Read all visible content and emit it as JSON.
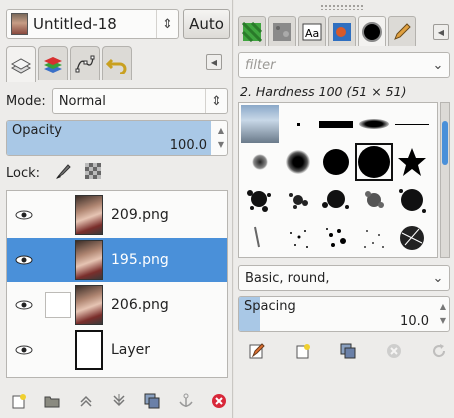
{
  "image_selector": {
    "name": "Untitled-18"
  },
  "auto_button": "Auto",
  "layers_panel": {
    "mode_label": "Mode:",
    "mode_value": "Normal",
    "opacity_label": "Opacity",
    "opacity_value": "100.0",
    "lock_label": "Lock:",
    "layers": [
      {
        "name": "209.png",
        "selected": false,
        "visible": true
      },
      {
        "name": "195.png",
        "selected": true,
        "visible": true
      },
      {
        "name": "206.png",
        "selected": false,
        "visible": true
      },
      {
        "name": "Layer",
        "selected": false,
        "visible": true
      }
    ]
  },
  "brushes_panel": {
    "filter_placeholder": "filter",
    "brush_title": "2. Hardness 100 (51 × 51)",
    "preset_value": "Basic, round,",
    "spacing_label": "Spacing",
    "spacing_value": "10.0"
  },
  "colors": {
    "selection": "#4a90d9",
    "slider_fill": "#a9c8e6"
  }
}
